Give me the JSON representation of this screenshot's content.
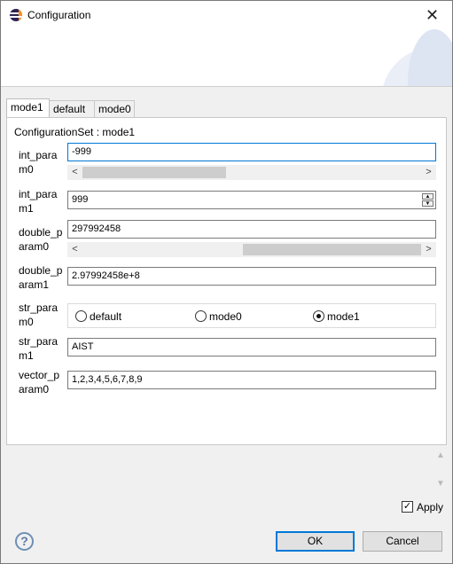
{
  "window": {
    "title": "Configuration",
    "close_glyph": "✕"
  },
  "tabs": [
    {
      "label": "mode1",
      "active": true
    },
    {
      "label": "default",
      "active": false
    },
    {
      "label": "mode0",
      "active": false
    }
  ],
  "config_set_label": "ConfigurationSet : mode1",
  "params": {
    "int_param0": {
      "label_line1": "int_para",
      "label_line2": "m0",
      "value": "-999"
    },
    "int_param1": {
      "label_line1": "int_para",
      "label_line2": "m1",
      "value": "999"
    },
    "double_param0": {
      "label_line1": "double_p",
      "label_line2": "aram0",
      "value": "297992458"
    },
    "double_param1": {
      "label_line1": "double_p",
      "label_line2": "aram1",
      "value": "2.97992458e+8"
    },
    "str_param0": {
      "label_line1": "str_para",
      "label_line2": "m0",
      "options": [
        "default",
        "mode0",
        "mode1"
      ],
      "selected": "mode1"
    },
    "str_param1": {
      "label_line1": "str_para",
      "label_line2": "m1",
      "value": "AIST"
    },
    "vector_param0": {
      "label_line1": "vector_p",
      "label_line2": "aram0",
      "value": "1,2,3,4,5,6,7,8,9"
    }
  },
  "scrollbar_glyphs": {
    "left": "<",
    "right": ">",
    "up": "▲",
    "down": "▼"
  },
  "apply": {
    "label": "Apply",
    "checked": true,
    "check_glyph": "✓"
  },
  "help_glyph": "?",
  "buttons": {
    "ok": "OK",
    "cancel": "Cancel"
  }
}
